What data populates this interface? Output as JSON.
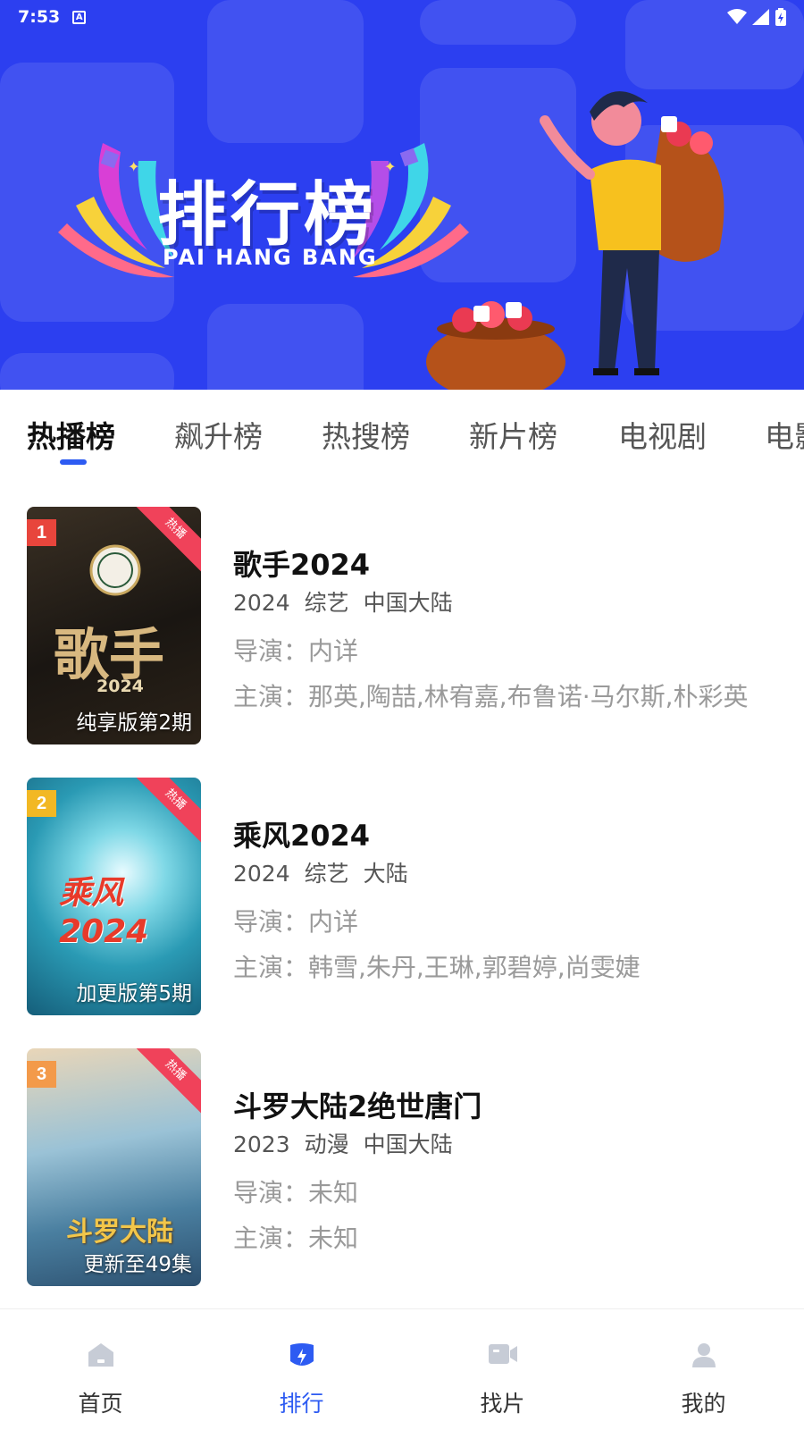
{
  "status_bar": {
    "time": "7:53",
    "notif_icon": "A"
  },
  "banner": {
    "title": "排行榜",
    "subtitle": "PAI HANG BANG"
  },
  "tabs": [
    {
      "label": "热播榜",
      "active": true
    },
    {
      "label": "飙升榜",
      "active": false
    },
    {
      "label": "热搜榜",
      "active": false
    },
    {
      "label": "新片榜",
      "active": false
    },
    {
      "label": "电视剧",
      "active": false
    },
    {
      "label": "电影",
      "active": false
    }
  ],
  "items": [
    {
      "rank": "1",
      "rank_color": "#e8453c",
      "badge": "热播",
      "episode": "纯享版第2期",
      "poster_text": "歌手",
      "poster_year": "2024",
      "title": "歌手2024",
      "year": "2024",
      "genre": "综艺",
      "region": "中国大陆",
      "director": "导演：内详",
      "cast": "主演：那英,陶喆,林宥嘉,布鲁诺·马尔斯,朴彩英"
    },
    {
      "rank": "2",
      "rank_color": "#f2b824",
      "badge": "热播",
      "episode": "加更版第5期",
      "poster_text": "乘风2024",
      "title": "乘风2024",
      "year": "2024",
      "genre": "综艺",
      "region": "大陆",
      "director": "导演：内详",
      "cast": "主演：韩雪,朱丹,王琳,郭碧婷,尚雯婕"
    },
    {
      "rank": "3",
      "rank_color": "#f39a4a",
      "badge": "热播",
      "episode": "更新至49集",
      "poster_text": "斗罗大陆",
      "title": "斗罗大陆2绝世唐门",
      "year": "2023",
      "genre": "动漫",
      "region": "中国大陆",
      "director": "导演：未知",
      "cast": "主演：未知"
    }
  ],
  "bottom_nav": [
    {
      "label": "首页",
      "icon": "home-icon",
      "active": false
    },
    {
      "label": "排行",
      "icon": "ranking-icon",
      "active": true
    },
    {
      "label": "找片",
      "icon": "video-icon",
      "active": false
    },
    {
      "label": "我的",
      "icon": "user-icon",
      "active": false
    }
  ],
  "colors": {
    "accent": "#2d5bf2",
    "banner_bg": "#2c3ff0",
    "badge_red": "#f0425a"
  }
}
